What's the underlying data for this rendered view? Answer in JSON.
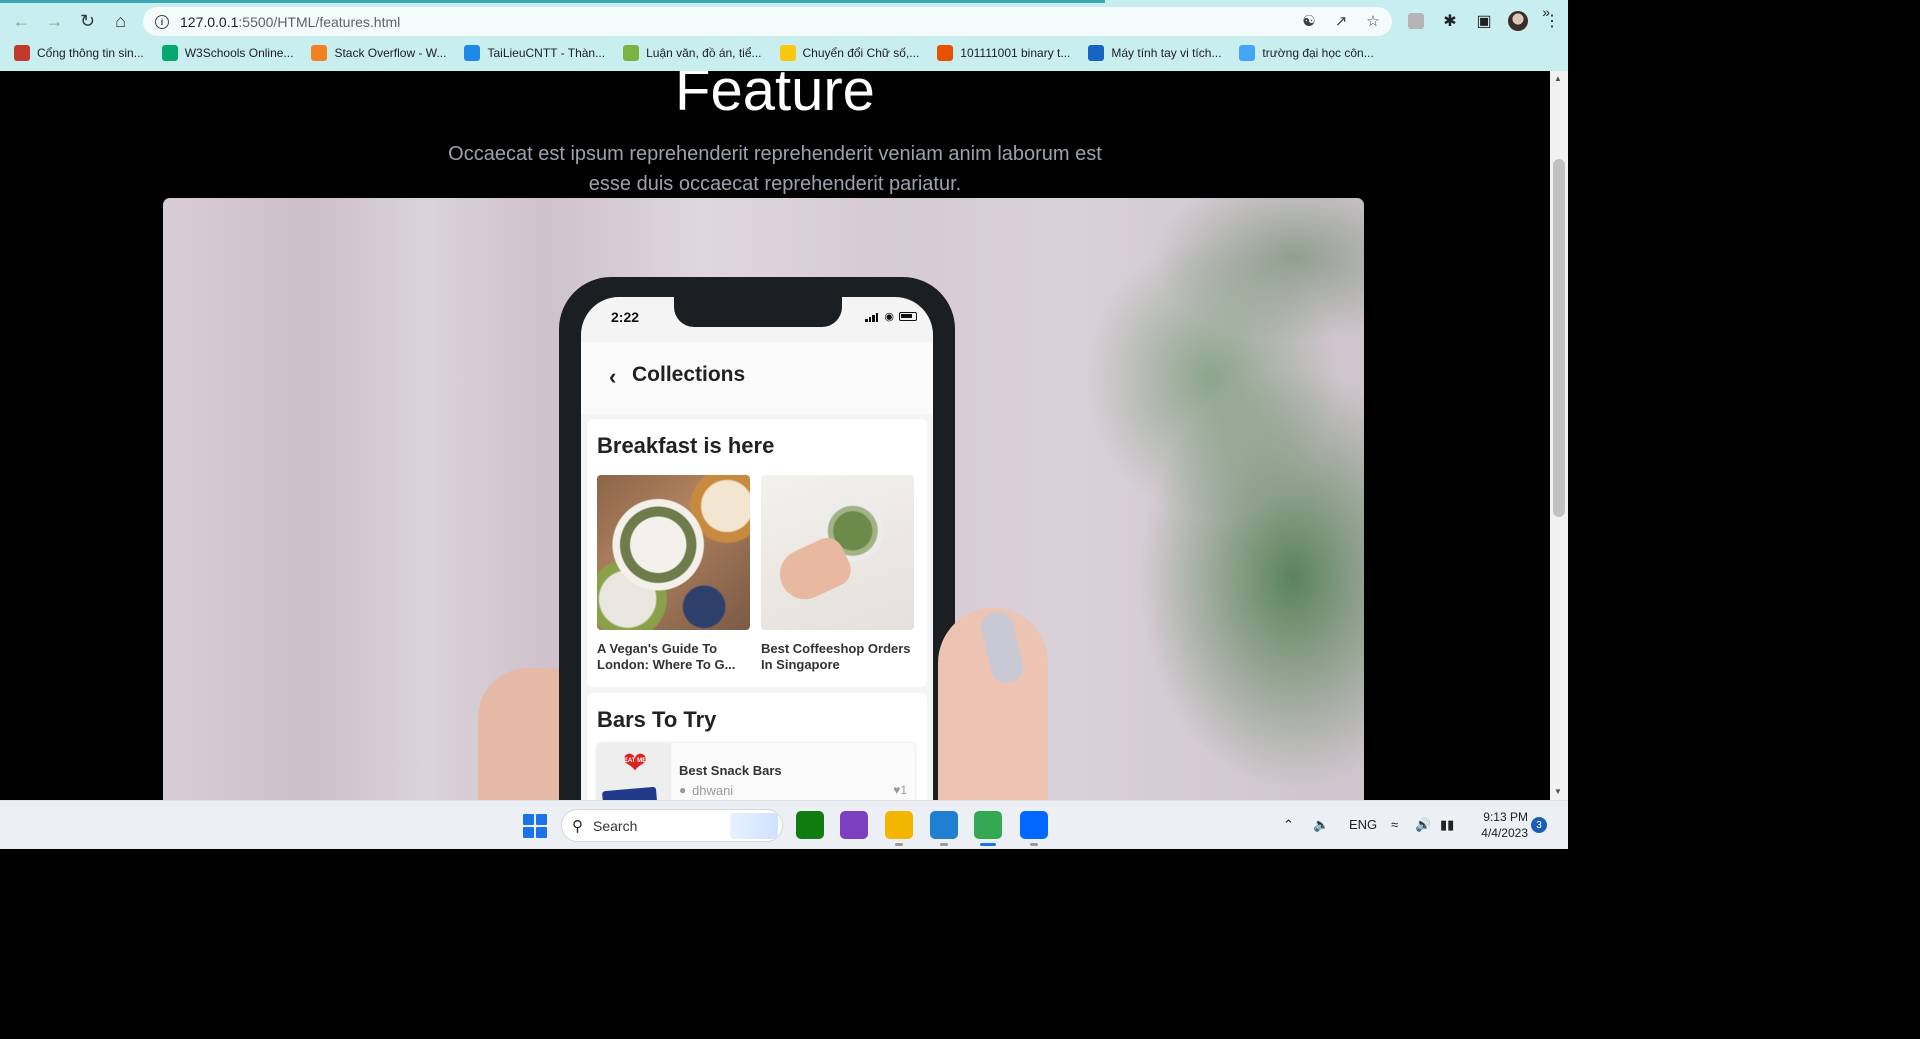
{
  "browser": {
    "url_host": "127.0.0.1",
    "url_path": ":5500/HTML/features.html",
    "bookmarks": [
      {
        "label": "Cổng thông tin sin...",
        "color": "#c0392b",
        "icon": "university-icon"
      },
      {
        "label": "W3Schools Online...",
        "color": "#04aa6d",
        "icon": "w3schools-icon"
      },
      {
        "label": "Stack Overflow - W...",
        "color": "#f48024",
        "icon": "stackoverflow-icon"
      },
      {
        "label": "TaiLieuCNTT - Thàn...",
        "color": "#1e88e5",
        "icon": "tailieu-icon"
      },
      {
        "label": "Luận văn, đồ án, tiể...",
        "color": "#7cb342",
        "icon": "luanvan-icon"
      },
      {
        "label": "Chuyển đổi Chữ số,...",
        "color": "#f9c80e",
        "icon": "converter-icon"
      },
      {
        "label": "101111001 binary t...",
        "color": "#e65100",
        "icon": "rapidtables-icon"
      },
      {
        "label": "Máy tính tay vi tích...",
        "color": "#1565c0",
        "icon": "calculator-icon"
      },
      {
        "label": "trường đại học côn...",
        "color": "#42a5f5",
        "icon": "search-result-icon"
      }
    ],
    "more_bookmarks": "»"
  },
  "page": {
    "title": "Feature",
    "subtitle": "Occaecat est ipsum reprehenderit reprehenderit veniam anim laborum est esse duis occaecat reprehenderit pariatur."
  },
  "phone": {
    "time": "2:22",
    "header_title": "Collections",
    "section1_title": "Breakfast is here",
    "card1_caption": "A Vegan's Guide To London: Where To G...",
    "card2_caption": "Best Coffeeshop Orders In Singapore",
    "section2_title": "Bars To Try",
    "heart_badge_text": "EAT ME",
    "list_title": "Best Snack Bars",
    "list_user": "dhwani",
    "list_likes": "1"
  },
  "taskbar": {
    "search_label": "Search",
    "language": "ENG",
    "time": "9:13 PM",
    "date": "4/4/2023",
    "notifications": "3",
    "apps": [
      {
        "name": "xbox-app",
        "color": "#107c10"
      },
      {
        "name": "clipchamp-app",
        "color": "#7b3fbf"
      },
      {
        "name": "file-explorer-app",
        "color": "#f2b600"
      },
      {
        "name": "vscode-app",
        "color": "#1f80d0"
      },
      {
        "name": "chrome-app",
        "color": "#34a853"
      },
      {
        "name": "zalo-app",
        "color": "#0068ff"
      }
    ]
  }
}
